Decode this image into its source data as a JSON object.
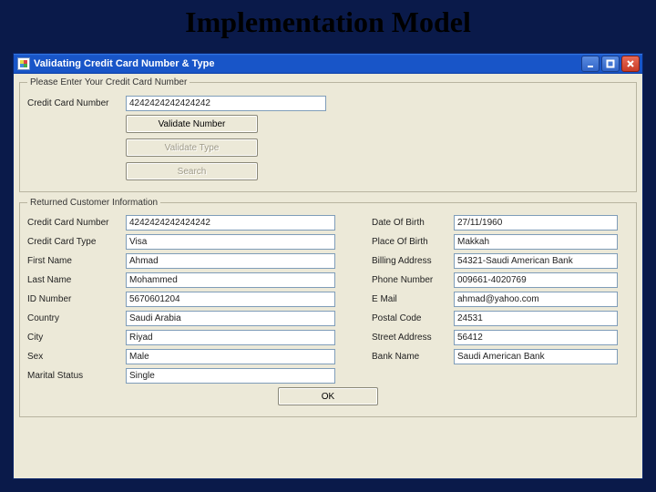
{
  "slide": {
    "title": "Implementation Model"
  },
  "window": {
    "title": "Validating Credit Card Number & Type",
    "buttons": {
      "min": "_",
      "max": "❐",
      "close": "✕"
    }
  },
  "top": {
    "legend": "Please Enter Your Credit Card Number",
    "cc_label": "Credit Card Number",
    "cc_value": "4242424242424242",
    "btn_validate_number": "Validate Number",
    "btn_validate_type": "Validate Type",
    "btn_search": "Search"
  },
  "info": {
    "legend": "Returned Customer Information",
    "left": {
      "cc_number": {
        "label": "Credit Card Number",
        "value": "4242424242424242"
      },
      "cc_type": {
        "label": "Credit Card Type",
        "value": "Visa"
      },
      "first_name": {
        "label": "First Name",
        "value": "Ahmad"
      },
      "last_name": {
        "label": "Last Name",
        "value": "Mohammed"
      },
      "id_number": {
        "label": "ID Number",
        "value": "5670601204"
      },
      "country": {
        "label": "Country",
        "value": "Saudi Arabia"
      },
      "city": {
        "label": "City",
        "value": "Riyad"
      },
      "sex": {
        "label": "Sex",
        "value": "Male"
      },
      "marital": {
        "label": "Marital Status",
        "value": "Single"
      }
    },
    "right": {
      "dob": {
        "label": "Date Of Birth",
        "value": "27/11/1960"
      },
      "pob": {
        "label": "Place Of Birth",
        "value": "Makkah"
      },
      "billing": {
        "label": "Billing Address",
        "value": "54321-Saudi American Bank"
      },
      "phone": {
        "label": "Phone Number",
        "value": "009661-4020769"
      },
      "email": {
        "label": "E Mail",
        "value": "ahmad@yahoo.com"
      },
      "postal": {
        "label": "Postal Code",
        "value": "24531"
      },
      "street": {
        "label": "Street Address",
        "value": "56412"
      },
      "bank": {
        "label": "Bank Name",
        "value": "Saudi American Bank"
      }
    }
  },
  "ok_label": "OK"
}
